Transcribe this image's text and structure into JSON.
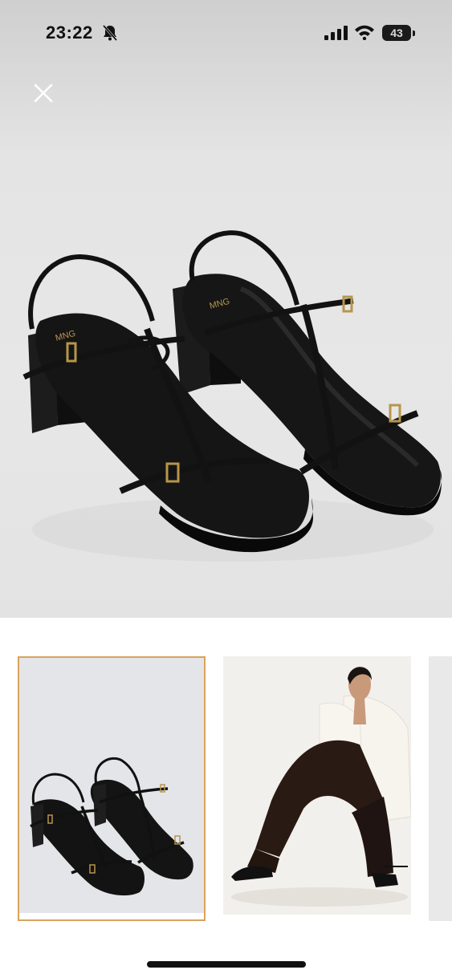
{
  "status_bar": {
    "time": "23:22",
    "battery_level": "43",
    "icons": [
      "bell-slash-icon",
      "cellular-signal-icon",
      "wifi-icon",
      "battery-icon"
    ]
  },
  "viewer": {
    "close_icon": "close-icon",
    "main_image": "black strappy block-heel sandals",
    "brand_mark": "MNG"
  },
  "gallery": {
    "thumbnails": [
      {
        "image": "sandals-product-thumbnail",
        "selected": true
      },
      {
        "image": "model-wearing-sandals-thumbnail",
        "selected": false
      },
      {
        "image": "next-thumbnail-partial",
        "selected": false
      }
    ],
    "selected_border_color": "#d9a35c"
  }
}
